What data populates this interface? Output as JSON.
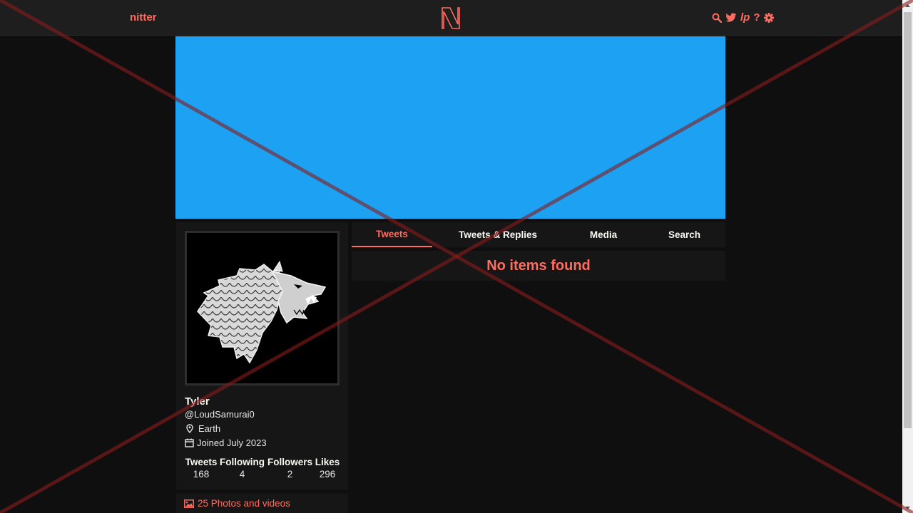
{
  "nav": {
    "brand": "nitter",
    "icons": [
      "search-icon",
      "bird-icon",
      "rss-icon",
      "help-icon",
      "gear-icon"
    ],
    "rss_text": "lp",
    "help_text": "?"
  },
  "banner": {
    "color": "#1da1f2"
  },
  "profile": {
    "fullname": "Tyler",
    "username": "@LoudSamurai0",
    "location": "Earth",
    "joined": "Joined July 2023",
    "stats": [
      {
        "label": "Tweets",
        "value": "168"
      },
      {
        "label": "Following",
        "value": "4"
      },
      {
        "label": "Followers",
        "value": "2"
      },
      {
        "label": "Likes",
        "value": "296"
      }
    ],
    "photos": "25 Photos and videos"
  },
  "tabs": [
    {
      "label": "Tweets",
      "active": true
    },
    {
      "label": "Tweets & Replies",
      "active": false
    },
    {
      "label": "Media",
      "active": false
    },
    {
      "label": "Search",
      "active": false
    }
  ],
  "timeline": {
    "empty_message": "No items found"
  },
  "colors": {
    "accent": "#ff6c60",
    "background": "#0f0f0f",
    "panel": "#161616",
    "banner": "#1da1f2"
  }
}
